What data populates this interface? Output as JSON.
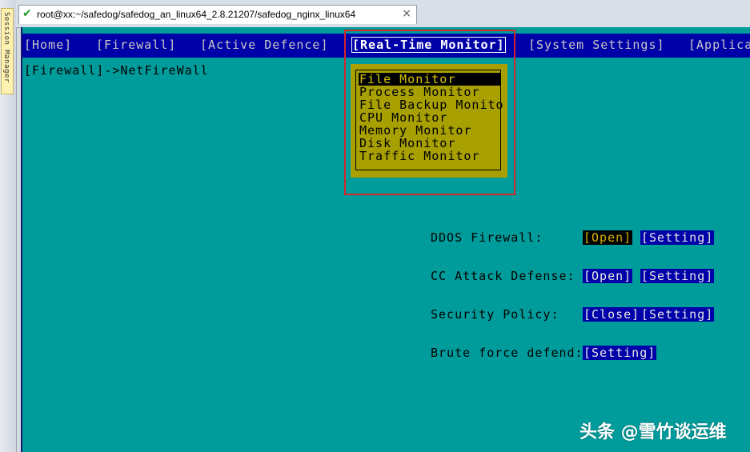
{
  "side_panel": {
    "label": "Session Manager"
  },
  "tab": {
    "title": "root@xx:~/safedog/safedog_an_linux64_2.8.21207/safedog_nginx_linux64",
    "status_icon": "check-icon",
    "close_glyph": "×"
  },
  "menu": {
    "items": [
      {
        "label": "[Home]"
      },
      {
        "label": "[Firewall]"
      },
      {
        "label": "[Active Defence]"
      },
      {
        "label": "[Real-Time Monitor]",
        "active": true
      },
      {
        "label": "[System Settings]"
      },
      {
        "label": "[Applica"
      }
    ]
  },
  "breadcrumb": "[Firewall]->NetFireWall",
  "dropdown": {
    "items": [
      {
        "label": "File Monitor",
        "selected": true
      },
      {
        "label": "Process Monitor"
      },
      {
        "label": "File Backup Monito"
      },
      {
        "label": "CPU Monitor"
      },
      {
        "label": "Memory Monitor"
      },
      {
        "label": "Disk Monitor"
      },
      {
        "label": "Traffic Monitor"
      }
    ]
  },
  "settings": {
    "ddos": {
      "label": "DDOS Firewall:",
      "state": "[Open]",
      "setting": "[Setting]"
    },
    "cc": {
      "label": "CC Attack Defense:",
      "state": "[Open]",
      "setting": "[Setting]"
    },
    "policy": {
      "label": "Security Policy:",
      "state": "[Close]",
      "setting": "[Setting]"
    },
    "brute": {
      "label": "Brute force defend:",
      "setting": "[Setting]"
    }
  },
  "watermark": "头条 @雪竹谈运维",
  "colors": {
    "terminal_bg": "#009b9b",
    "menubar_bg": "#0000a8",
    "dropdown_bg": "#a8a000",
    "annotation": "#d2262c"
  }
}
